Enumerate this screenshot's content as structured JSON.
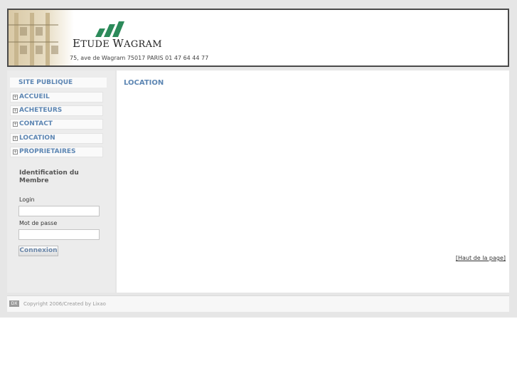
{
  "header": {
    "brand_first": "E",
    "brand_rest1": "TUDE ",
    "brand_second": "W",
    "brand_rest2": "AGRAM",
    "address": "75, ave de Wagram 75017 PARIS 01 47 64 44 77"
  },
  "sidebar": {
    "site_title": "SITE PUBLIQUE",
    "items": [
      {
        "label": "ACCUEIL",
        "expander": "+"
      },
      {
        "label": "ACHETEURS",
        "expander": "+"
      },
      {
        "label": "CONTACT",
        "expander": "+"
      },
      {
        "label": "LOCATION",
        "expander": "+"
      },
      {
        "label": "PROPRIETAIRES",
        "expander": "+"
      }
    ],
    "login_box": {
      "title": "Identification du Membre",
      "login_label": "Login",
      "login_value": "",
      "password_label": "Mot de passe",
      "password_value": "",
      "submit_label": "Connexion"
    }
  },
  "main": {
    "title": "LOCATION",
    "top_link": "[Haut de la page]"
  },
  "footer": {
    "icon_text": "DX",
    "text": "Copyright 2006/Created by Lixao"
  },
  "colors": {
    "accent": "#5d86b3",
    "logo_green": "#2c8a5a",
    "frame": "#4a4a4a",
    "background": "#e6e6e6"
  }
}
